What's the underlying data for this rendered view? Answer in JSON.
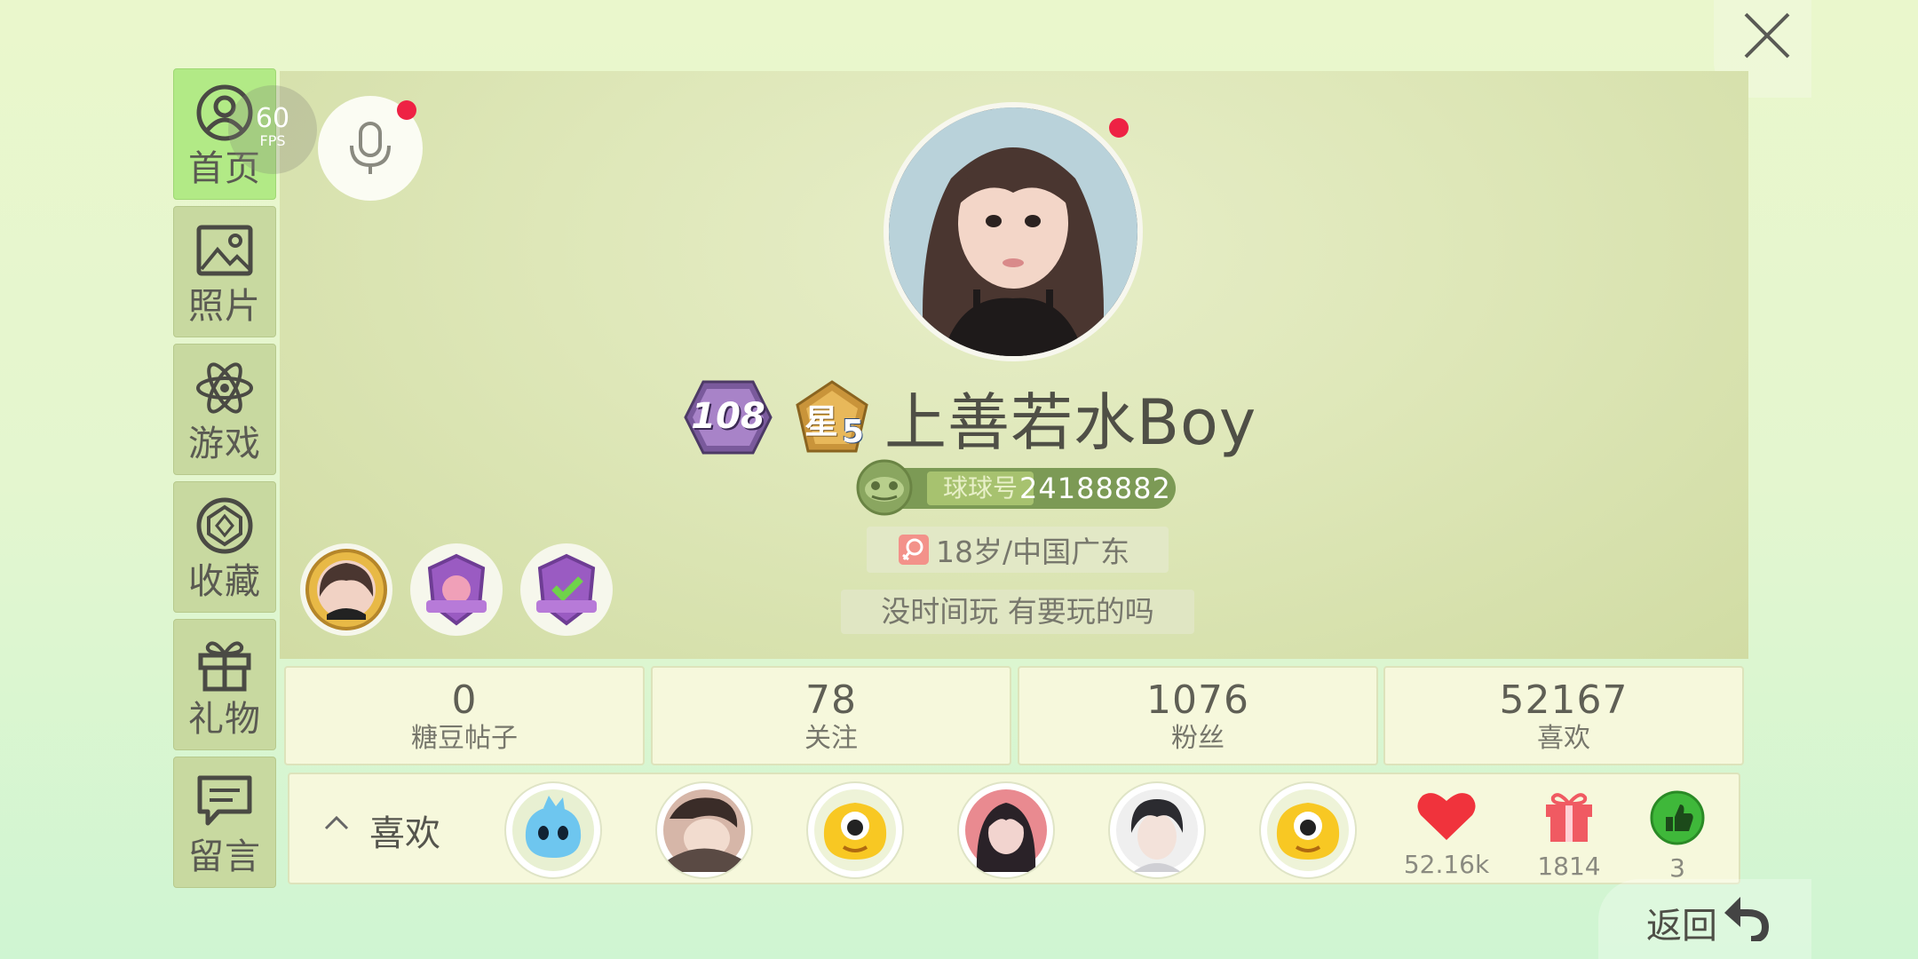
{
  "sidebar": {
    "items": [
      {
        "label": "首页",
        "icon": "profile-icon",
        "active": true
      },
      {
        "label": "照片",
        "icon": "image-icon",
        "active": false
      },
      {
        "label": "游戏",
        "icon": "atom-icon",
        "active": false
      },
      {
        "label": "收藏",
        "icon": "gem-icon",
        "active": false
      },
      {
        "label": "礼物",
        "icon": "gift-icon",
        "active": false
      },
      {
        "label": "留言",
        "icon": "message-icon",
        "active": false
      }
    ]
  },
  "fps": {
    "value": "60",
    "unit": "FPS"
  },
  "profile": {
    "level": "108",
    "star_char": "星",
    "star_level": "5",
    "nickname": "上善若水Boy",
    "id_label": "球球号",
    "id_number": "24188882",
    "location": "18岁/中国广东",
    "signature": "没时间玩 有要玩的吗"
  },
  "stats": [
    {
      "value": "0",
      "label": "糖豆帖子"
    },
    {
      "value": "78",
      "label": "关注"
    },
    {
      "value": "1076",
      "label": "粉丝"
    },
    {
      "value": "52167",
      "label": "喜欢"
    }
  ],
  "likes_bar": {
    "title": "喜欢",
    "metrics": [
      {
        "icon": "heart-icon",
        "value": "52.16k"
      },
      {
        "icon": "gift-box-icon",
        "value": "1814"
      },
      {
        "icon": "thumbs-up-icon",
        "value": "3"
      }
    ]
  },
  "back_label": "返回",
  "colors": {
    "accent_green": "#b2ea86",
    "notify_red": "#ee2244",
    "heart_red": "#f0333c",
    "id_pill_green": "#7c9a55"
  }
}
